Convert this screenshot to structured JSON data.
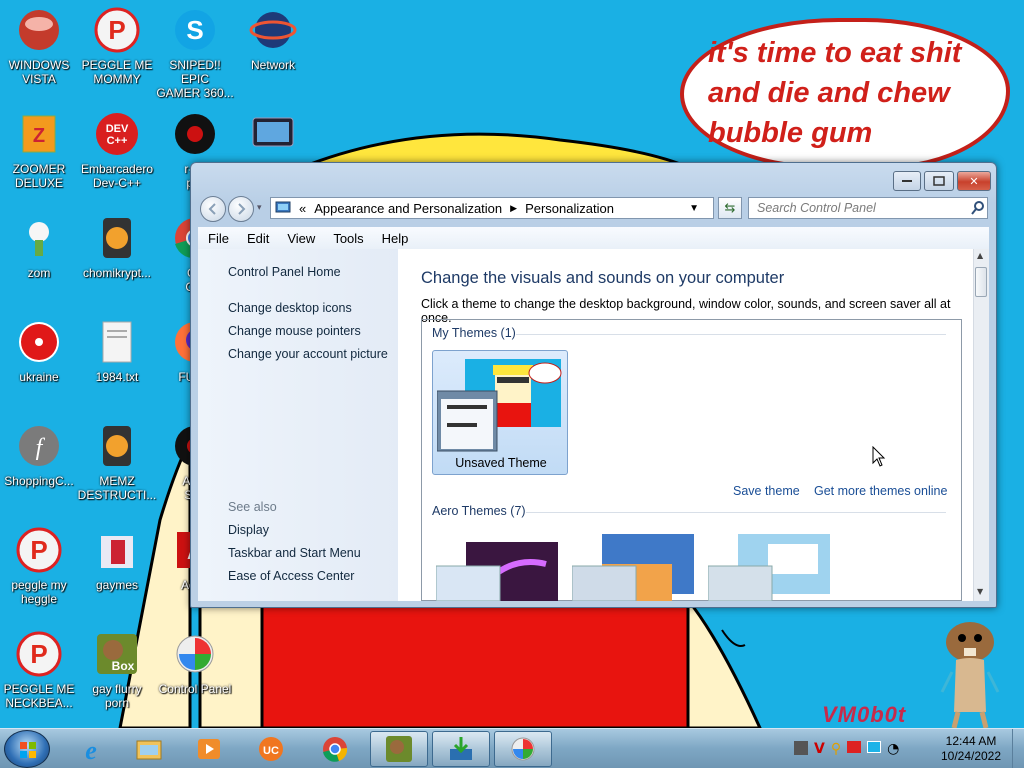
{
  "desktop": {
    "speech_bubble_text": "it's time to eat shit\nand die and chew\nbubble gum",
    "watermark": "VM0b0t",
    "icons": [
      {
        "label": "WINDOWS\nVISTA",
        "icon": "vista-orb-icon"
      },
      {
        "label": "PEGGLE ME\nMOMMY",
        "icon": "peggle-icon"
      },
      {
        "label": "SNIPED!! EPIC\nGAMER 360...",
        "icon": "skype-icon"
      },
      {
        "label": "Network",
        "icon": "network-icon"
      },
      {
        "label": "ZOOMER\nDELUXE",
        "icon": "zoomer-deluxe-icon"
      },
      {
        "label": "Embarcadero\nDev-C++",
        "icon": "devcpp-icon"
      },
      {
        "label": "r-an\npar",
        "icon": "app-icon"
      },
      {
        "label": "",
        "icon": "monitor-icon"
      },
      {
        "label": "zom",
        "icon": "plant-icon"
      },
      {
        "label": "chomikrypt...",
        "icon": "chomikrypt-icon"
      },
      {
        "label": "Go\nChr",
        "icon": "chrome-icon"
      },
      {
        "label": "ukraine",
        "icon": "radiation-icon"
      },
      {
        "label": "1984.txt",
        "icon": "text-file-icon"
      },
      {
        "label": "FURR",
        "icon": "firefox-icon"
      },
      {
        "label": "ShoppingC...",
        "icon": "flash-icon"
      },
      {
        "label": "MEMZ\nDESTRUCTI...",
        "icon": "memz-icon"
      },
      {
        "label": "Angr\nSea",
        "icon": "app-icon"
      },
      {
        "label": "peggle my\nheggle",
        "icon": "peggle-icon"
      },
      {
        "label": "gaymes",
        "icon": "folder-icon"
      },
      {
        "label": "Adob",
        "icon": "adobe-icon"
      },
      {
        "label": "PEGGLE ME\nNECKBEA...",
        "icon": "peggle-icon"
      },
      {
        "label": "gay flurry\nporn",
        "icon": "box-icon"
      },
      {
        "label": "Control Panel",
        "icon": "control-panel-icon"
      }
    ]
  },
  "window": {
    "breadcrumb": {
      "prefix": "«",
      "items": [
        "Appearance and Personalization",
        "Personalization"
      ]
    },
    "search_placeholder": "Search Control Panel",
    "menu": [
      "File",
      "Edit",
      "View",
      "Tools",
      "Help"
    ],
    "left_pane": {
      "home_link": "Control Panel Home",
      "links": [
        "Change desktop icons",
        "Change mouse pointers",
        "Change your account picture"
      ],
      "see_also_label": "See also",
      "see_also": [
        "Display",
        "Taskbar and Start Menu",
        "Ease of Access Center"
      ]
    },
    "main": {
      "heading": "Change the visuals and sounds on your computer",
      "description": "Click a theme to change the desktop background, window color, sounds, and screen saver all at once.",
      "my_themes_label": "My Themes (1)",
      "unsaved_theme": "Unsaved Theme",
      "save_theme": "Save theme",
      "get_more_themes": "Get more themes online",
      "aero_themes_label": "Aero Themes (7)"
    }
  },
  "taskbar": {
    "pinned": [
      "internet-explorer-icon",
      "windows-explorer-icon",
      "media-player-icon",
      "uc-browser-icon",
      "chrome-icon",
      "box-app-icon",
      "download-icon",
      "control-panel-icon"
    ],
    "clock_time": "12:44 AM",
    "clock_date": "10/24/2022"
  },
  "colors": {
    "desktop_bg": "#1ab0e4",
    "link_blue": "#1a4e96",
    "heading_blue": "#1e3a66",
    "bubble_red": "#d0201a"
  }
}
